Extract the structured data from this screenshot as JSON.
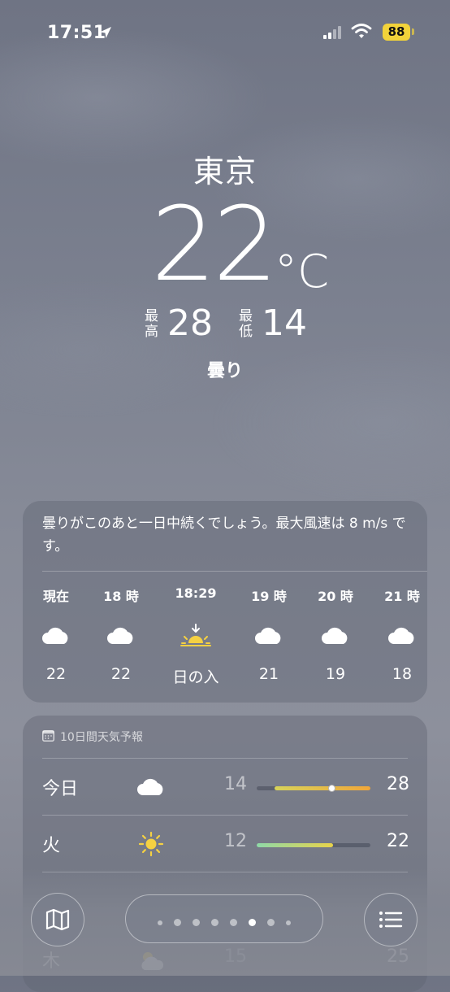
{
  "status_bar": {
    "time": "17:51",
    "battery": "88",
    "icons": [
      "location-arrow-icon",
      "cellular-signal-icon",
      "wifi-icon",
      "battery-icon"
    ],
    "battery_color": "#f2d33a"
  },
  "current": {
    "city": "東京",
    "temperature": "22",
    "unit": "°C",
    "high_label": "最高",
    "high": "28",
    "low_label": "最低",
    "low": "14",
    "condition": "曇り"
  },
  "hourly": {
    "summary": "曇りがこのあと一日中続くでしょう。最大風速は 8 m/s です。",
    "items": [
      {
        "time": "現在",
        "icon": "cloud-icon",
        "value": "22"
      },
      {
        "time": "18 時",
        "icon": "cloud-icon",
        "value": "22"
      },
      {
        "time": "18:29",
        "icon": "sunset-icon",
        "value": "日の入"
      },
      {
        "time": "19 時",
        "icon": "cloud-icon",
        "value": "21"
      },
      {
        "time": "20 時",
        "icon": "cloud-icon",
        "value": "19"
      },
      {
        "time": "21 時",
        "icon": "cloud-icon",
        "value": "18"
      }
    ]
  },
  "daily": {
    "header": "10日間天気予報",
    "items": [
      {
        "day": "今日",
        "icon": "cloud-icon",
        "low": "14",
        "high": "28",
        "range_start": 0.16,
        "range_end": 1.0,
        "current": 0.66,
        "colors": [
          "#d7d35a",
          "#f0a63a"
        ]
      },
      {
        "day": "火",
        "icon": "sun-icon",
        "low": "12",
        "high": "22",
        "range_start": 0.0,
        "range_end": 0.67,
        "colors": [
          "#8fd9a8",
          "#e8d34a"
        ]
      },
      {
        "day": "木",
        "icon": "partly-cloudy-icon",
        "low": "15",
        "high": "25"
      }
    ]
  },
  "toolbar": {
    "map_button": "map-icon",
    "list_button": "list-icon",
    "pages": 7,
    "active_page": 5
  }
}
